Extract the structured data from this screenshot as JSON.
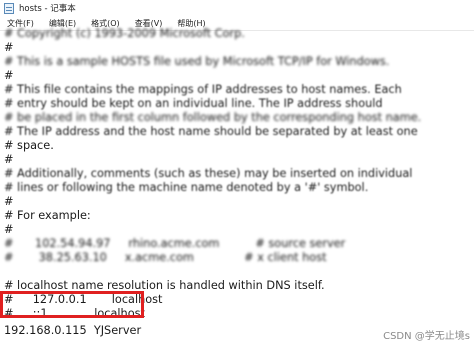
{
  "window": {
    "title": "hosts - 记事本"
  },
  "menu": [
    {
      "label": "文件(F)"
    },
    {
      "label": "编辑(E)"
    },
    {
      "label": "格式(O)"
    },
    {
      "label": "查看(V)"
    },
    {
      "label": "帮助(H)"
    }
  ],
  "editor": {
    "lines": [
      "# Copyright (c) 1993-2009 Microsoft Corp.",
      "#",
      "# This is a sample HOSTS file used by Microsoft TCP/IP for Windows.",
      "#",
      "# This file contains the mappings of IP addresses to host names. Each",
      "# entry should be kept on an individual line. The IP address should",
      "# be placed in the first column followed by the corresponding host name.",
      "# The IP address and the host name should be separated by at least one",
      "# space.",
      "#",
      "# Additionally, comments (such as these) may be inserted on individual",
      "# lines or following the machine name denoted by a '#' symbol.",
      "#",
      "# For example:",
      "#",
      "#      102.54.94.97     rhino.acme.com          # source server",
      "#       38.25.63.10     x.acme.com              # x client host",
      "",
      "# localhost name resolution is handled within DNS itself.",
      "#\t127.0.0.1       localhost",
      "#\t::1             localhost",
      "192.168.0.115  YJServer"
    ]
  },
  "watermark": {
    "text": "CSDN @学无止境s"
  },
  "colors": {
    "highlight_border": "#e02020"
  }
}
